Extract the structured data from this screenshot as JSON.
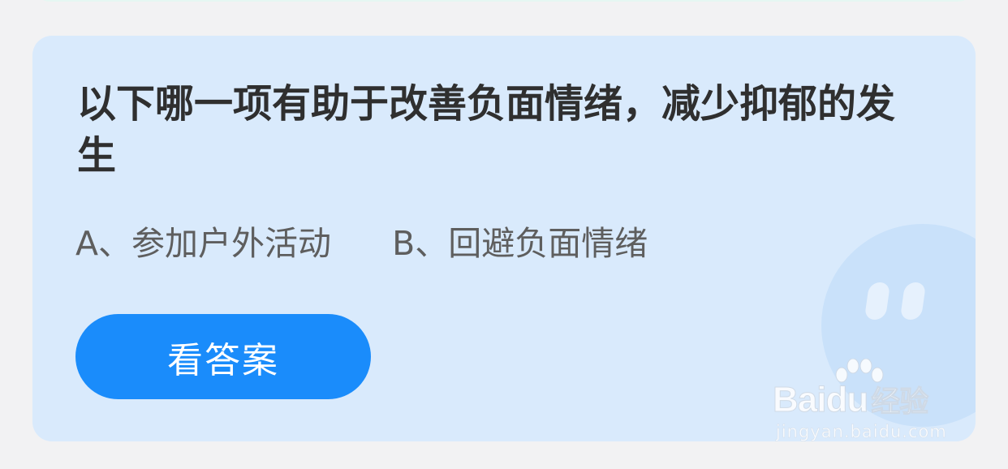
{
  "quiz": {
    "question": "以下哪一项有助于改善负面情绪，减少抑郁的发生",
    "option_a": "A、参加户外活动",
    "option_b": "B、回避负面情绪",
    "answer_button_label": "看答案"
  },
  "mascot": {
    "icon": "smiley-mascot-icon"
  },
  "watermark": {
    "icon": "baidu-paw-icon",
    "brand": "Bai",
    "brand_du": "du",
    "brand_cn": "经验",
    "url": "jingyan.baidu.com"
  },
  "colors": {
    "page_background": "#f2f2f3",
    "card_background": "#d9eafc",
    "button_background": "#1a8cfb",
    "question_text": "#2f2f2f",
    "option_text": "#5e5e5e"
  }
}
